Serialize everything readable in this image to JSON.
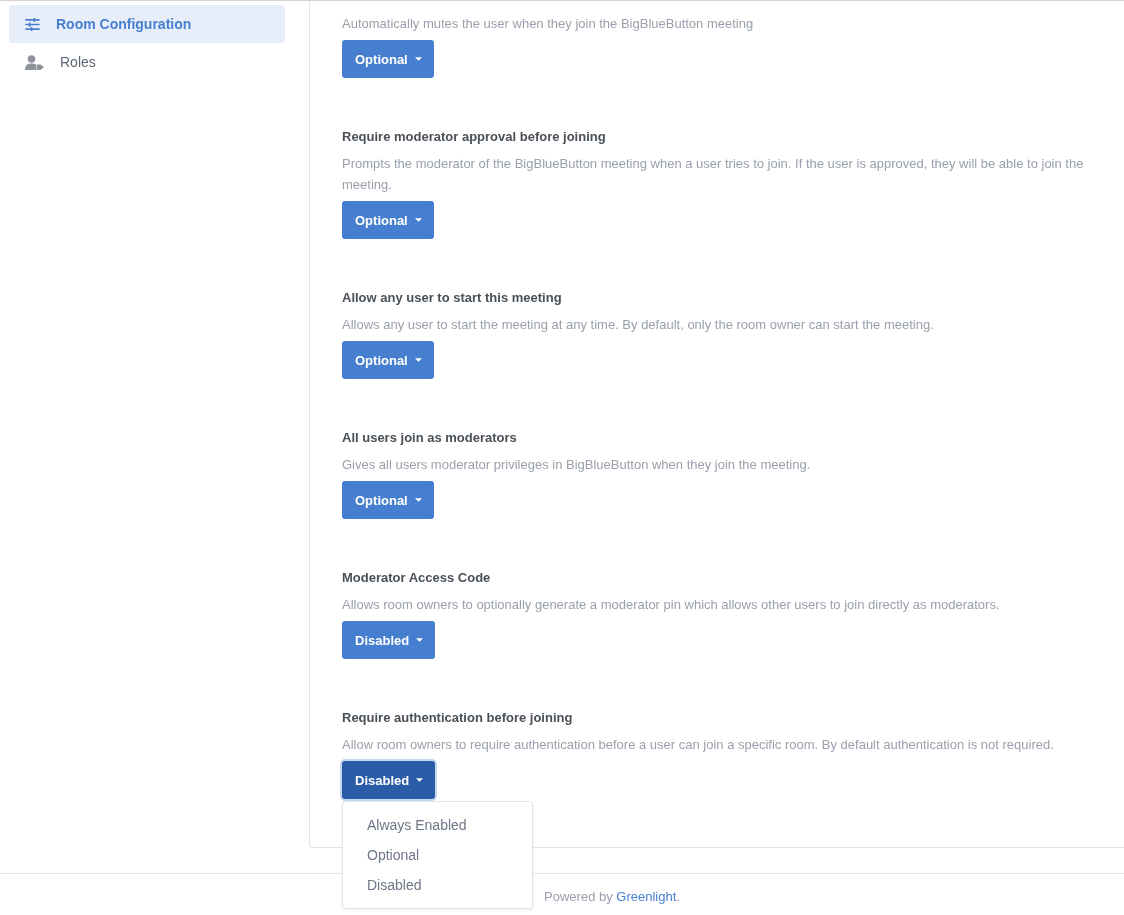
{
  "sidebar": {
    "items": [
      {
        "label": "Room Configuration",
        "selected": true
      },
      {
        "label": "Roles",
        "selected": false
      }
    ]
  },
  "settings": [
    {
      "description": "Automatically mutes the user when they join the BigBlueButton meeting",
      "value": "Optional",
      "open": false
    },
    {
      "title": "Require moderator approval before joining",
      "description": "Prompts the moderator of the BigBlueButton meeting when a user tries to join. If the user is approved, they will be able to join the meeting.",
      "value": "Optional",
      "open": false
    },
    {
      "title": "Allow any user to start this meeting",
      "description": "Allows any user to start the meeting at any time. By default, only the room owner can start the meeting.",
      "value": "Optional",
      "open": false
    },
    {
      "title": "All users join as moderators",
      "description": "Gives all users moderator privileges in BigBlueButton when they join the meeting.",
      "value": "Optional",
      "open": false
    },
    {
      "title": "Moderator Access Code",
      "description": "Allows room owners to optionally generate a moderator pin which allows other users to join directly as moderators.",
      "value": "Disabled",
      "open": false
    },
    {
      "title": "Require authentication before joining",
      "description": "Allow room owners to require authentication before a user can join a specific room. By default authentication is not required.",
      "value": "Disabled",
      "open": true
    }
  ],
  "dropdown_menu": {
    "items": [
      "Always Enabled",
      "Optional",
      "Disabled"
    ]
  },
  "footer": {
    "text_before": "Powered by",
    "link": "Greenlight",
    "text_after": "."
  }
}
